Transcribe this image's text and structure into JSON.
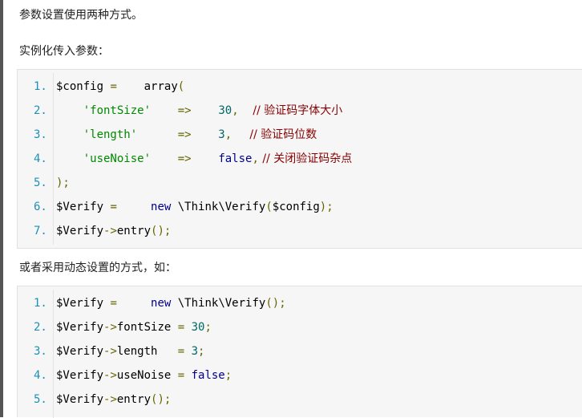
{
  "paragraphs": {
    "p1": "参数设置使用两种方式。",
    "p2": "实例化传入参数：",
    "p3": "或者采用动态设置的方式，如："
  },
  "block1": [
    {
      "n": "1.",
      "tokens": [
        {
          "t": "$config",
          "c": "pl"
        },
        {
          "t": " = ",
          "c": "op"
        },
        {
          "t": "   array",
          "c": "pl"
        },
        {
          "t": "(",
          "c": "op"
        }
      ]
    },
    {
      "n": "2.",
      "tokens": [
        {
          "t": "    'fontSize'",
          "c": "str"
        },
        {
          "t": "    => ",
          "c": "op"
        },
        {
          "t": "   30",
          "c": "num"
        },
        {
          "t": ",",
          "c": "op"
        },
        {
          "t": "    // 验证码字体大小",
          "c": "com"
        }
      ]
    },
    {
      "n": "3.",
      "tokens": [
        {
          "t": "    'length'",
          "c": "str"
        },
        {
          "t": "      => ",
          "c": "op"
        },
        {
          "t": "   3",
          "c": "num"
        },
        {
          "t": ",",
          "c": "op"
        },
        {
          "t": "     // 验证码位数",
          "c": "com"
        }
      ]
    },
    {
      "n": "4.",
      "tokens": [
        {
          "t": "    'useNoise'",
          "c": "str"
        },
        {
          "t": "    => ",
          "c": "op"
        },
        {
          "t": "   false",
          "c": "kw"
        },
        {
          "t": ",",
          "c": "op"
        },
        {
          "t": " // 关闭验证码杂点",
          "c": "com"
        }
      ]
    },
    {
      "n": "5.",
      "tokens": [
        {
          "t": ");",
          "c": "op"
        }
      ]
    },
    {
      "n": "6.",
      "tokens": [
        {
          "t": "$Verify",
          "c": "pl"
        },
        {
          "t": " = ",
          "c": "op"
        },
        {
          "t": "    new",
          "c": "kw"
        },
        {
          "t": " \\Think\\Verify",
          "c": "pl"
        },
        {
          "t": "(",
          "c": "op"
        },
        {
          "t": "$config",
          "c": "pl"
        },
        {
          "t": ");",
          "c": "op"
        }
      ]
    },
    {
      "n": "7.",
      "tokens": [
        {
          "t": "$Verify",
          "c": "pl"
        },
        {
          "t": "->",
          "c": "op"
        },
        {
          "t": "entry",
          "c": "pl"
        },
        {
          "t": "();",
          "c": "op"
        }
      ]
    }
  ],
  "block2": [
    {
      "n": "1.",
      "tokens": [
        {
          "t": "$Verify",
          "c": "pl"
        },
        {
          "t": " = ",
          "c": "op"
        },
        {
          "t": "    new",
          "c": "kw"
        },
        {
          "t": " \\Think\\Verify",
          "c": "pl"
        },
        {
          "t": "();",
          "c": "op"
        }
      ]
    },
    {
      "n": "2.",
      "tokens": [
        {
          "t": "$Verify",
          "c": "pl"
        },
        {
          "t": "->",
          "c": "op"
        },
        {
          "t": "fontSize ",
          "c": "pl"
        },
        {
          "t": "= ",
          "c": "op"
        },
        {
          "t": "30",
          "c": "num"
        },
        {
          "t": ";",
          "c": "op"
        }
      ]
    },
    {
      "n": "3.",
      "tokens": [
        {
          "t": "$Verify",
          "c": "pl"
        },
        {
          "t": "->",
          "c": "op"
        },
        {
          "t": "length   ",
          "c": "pl"
        },
        {
          "t": "= ",
          "c": "op"
        },
        {
          "t": "3",
          "c": "num"
        },
        {
          "t": ";",
          "c": "op"
        }
      ]
    },
    {
      "n": "4.",
      "tokens": [
        {
          "t": "$Verify",
          "c": "pl"
        },
        {
          "t": "->",
          "c": "op"
        },
        {
          "t": "useNoise ",
          "c": "pl"
        },
        {
          "t": "= ",
          "c": "op"
        },
        {
          "t": "false",
          "c": "kw"
        },
        {
          "t": ";",
          "c": "op"
        }
      ]
    },
    {
      "n": "5.",
      "tokens": [
        {
          "t": "$Verify",
          "c": "pl"
        },
        {
          "t": "->",
          "c": "op"
        },
        {
          "t": "entry",
          "c": "pl"
        },
        {
          "t": "();",
          "c": "op"
        }
      ]
    }
  ]
}
